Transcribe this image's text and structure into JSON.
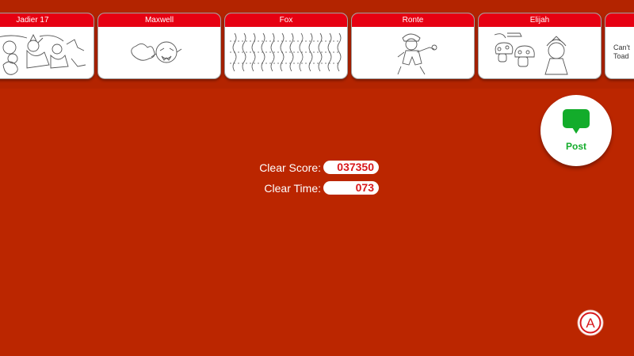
{
  "posts": [
    {
      "name": "Jadier 17",
      "text": ""
    },
    {
      "name": "Maxwell",
      "text": ""
    },
    {
      "name": "Fox",
      "text": ""
    },
    {
      "name": "Ronte",
      "text": ""
    },
    {
      "name": "Elijah",
      "text": ""
    },
    {
      "name": "",
      "text": "Can't\nToad"
    }
  ],
  "post_button": {
    "label": "Post",
    "icon": "speech-bubble-icon",
    "color": "#13ac2b"
  },
  "stats": {
    "score_label": "Clear Score:",
    "score_value": "037350",
    "time_label": "Clear Time:",
    "time_value": "073"
  },
  "a_button": {
    "glyph": "A"
  },
  "colors": {
    "background": "#bb2600",
    "card_header": "#e60012",
    "value_text": "#d8181c"
  }
}
